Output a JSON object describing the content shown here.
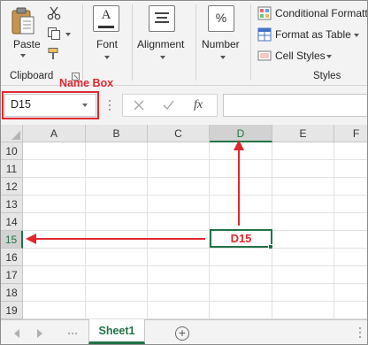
{
  "ribbon": {
    "clipboard": {
      "paste_label": "Paste",
      "group_label": "Clipboard"
    },
    "font": {
      "label": "Font"
    },
    "alignment": {
      "label": "Alignment"
    },
    "number": {
      "label": "Number",
      "symbol": "%"
    },
    "styles": {
      "conditional_formatting": "Conditional Formatt",
      "format_as_table": "Format as Table",
      "cell_styles": "Cell Styles",
      "group_label": "Styles"
    }
  },
  "formula_bar": {
    "name_box_value": "D15",
    "name_box_annotation": "Name Box",
    "fx_symbol": "fx",
    "formula_value": ""
  },
  "grid": {
    "columns": [
      "A",
      "B",
      "C",
      "D",
      "E",
      "F"
    ],
    "selected_column": "D",
    "rows": [
      "10",
      "11",
      "12",
      "13",
      "14",
      "15",
      "16",
      "17",
      "18",
      "19"
    ],
    "selected_row": "15",
    "active_cell_annotation": "D15"
  },
  "sheets": {
    "tabs": [
      "Sheet1"
    ],
    "active": "Sheet1",
    "add_symbol": "+"
  },
  "colors": {
    "excel_green": "#217346",
    "annotation_red": "#e0282e",
    "ribbon_bg": "#f3f3f3"
  }
}
